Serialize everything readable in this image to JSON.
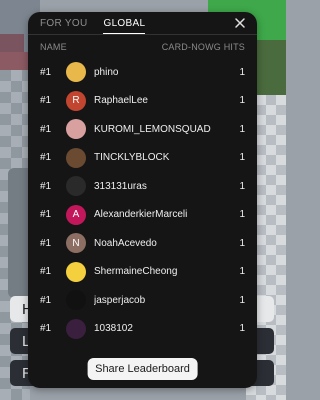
{
  "tabs": [
    {
      "label": "FOR YOU",
      "active": false
    },
    {
      "label": "GLOBAL",
      "active": true
    }
  ],
  "header": {
    "name": "NAME",
    "hits": "CARD-NOWG HITS"
  },
  "rows": [
    {
      "rank": "#1",
      "name": "phino",
      "hits": "1",
      "avatar_letter": "",
      "avatar_color": "#e8b84a"
    },
    {
      "rank": "#1",
      "name": "RaphaelLee",
      "hits": "1",
      "avatar_letter": "R",
      "avatar_color": "#c2462f"
    },
    {
      "rank": "#1",
      "name": "KUROMI_LEMONSQUAD",
      "hits": "1",
      "avatar_letter": "",
      "avatar_color": "#d9a0a0"
    },
    {
      "rank": "#1",
      "name": "TINCKLYBLOCK",
      "hits": "1",
      "avatar_letter": "",
      "avatar_color": "#6a4a30"
    },
    {
      "rank": "#1",
      "name": "313131uras",
      "hits": "1",
      "avatar_letter": "",
      "avatar_color": "#2a2a2a"
    },
    {
      "rank": "#1",
      "name": "AlexanderkierMarceli",
      "hits": "1",
      "avatar_letter": "A",
      "avatar_color": "#c2185b"
    },
    {
      "rank": "#1",
      "name": "NoahAcevedo",
      "hits": "1",
      "avatar_letter": "N",
      "avatar_color": "#8d6e63"
    },
    {
      "rank": "#1",
      "name": "ShermaineCheong",
      "hits": "1",
      "avatar_letter": "",
      "avatar_color": "#f4d03f"
    },
    {
      "rank": "#1",
      "name": "jasperjacob",
      "hits": "1",
      "avatar_letter": "",
      "avatar_color": "#111111"
    },
    {
      "rank": "#1",
      "name": "1038102",
      "hits": "1",
      "avatar_letter": "",
      "avatar_color": "#3a1f3f"
    }
  ],
  "share_label": "Share Leaderboard",
  "background_buttons": [
    "H",
    "L",
    "R"
  ]
}
